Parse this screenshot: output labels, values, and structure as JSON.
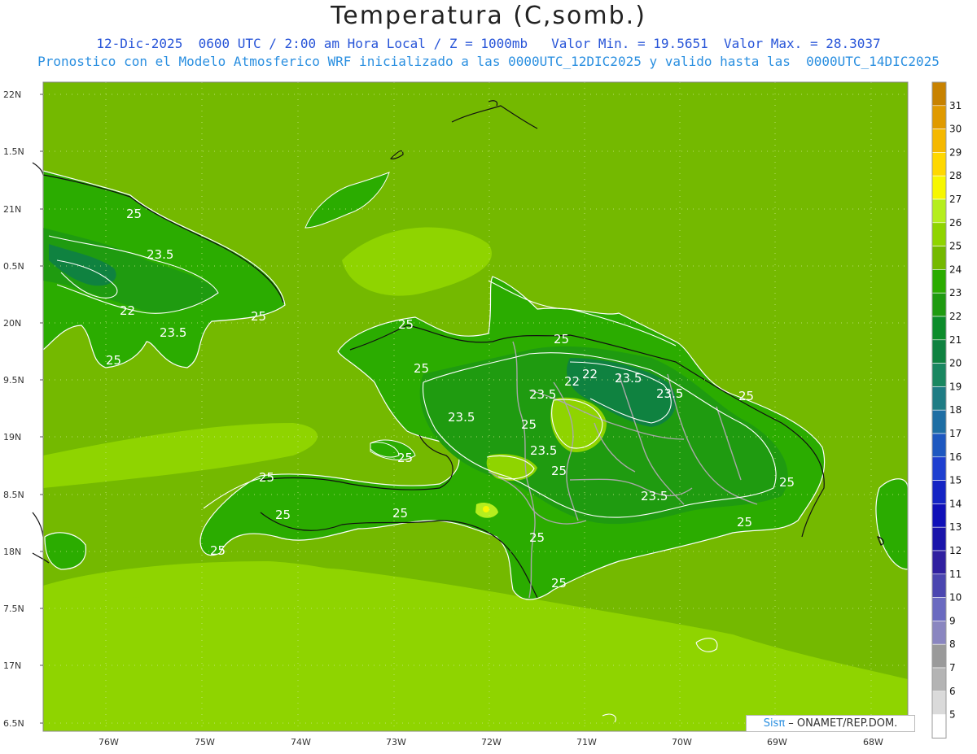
{
  "title": "Temperatura (C,somb.)",
  "subtitle_line1": "12-Dic-2025  0600 UTC / 2:00 am Hora Local / Z = 1000mb   Valor Min. = 19.5651  Valor Max. = 28.3037",
  "subtitle_line2": "Pronostico con el Modelo Atmosferico WRF inicializado a las 0000UTC_12DIC2025 y valido hasta las  0000UTC_14DIC2025",
  "credit": {
    "brand": "Sisπ",
    "text": " – ONAMET/REP.DOM."
  },
  "axes": {
    "x_ticks": [
      "76W",
      "75W",
      "74W",
      "73W",
      "72W",
      "71W",
      "70W",
      "69W",
      "68W"
    ],
    "y_ticks": [
      "22N",
      "1.5N",
      "21N",
      "0.5N",
      "20N",
      "9.5N",
      "19N",
      "8.5N",
      "18N",
      "7.5N",
      "17N",
      "6.5N"
    ]
  },
  "colorbar": {
    "levels": [
      "31",
      "30",
      "29",
      "28",
      "27",
      "26",
      "25",
      "24",
      "23",
      "22",
      "21",
      "20",
      "19",
      "18",
      "17",
      "16",
      "15",
      "14",
      "13",
      "12",
      "11",
      "10",
      "9",
      "8",
      "7",
      "6",
      "5"
    ],
    "colors": [
      "#c88200",
      "#e09a00",
      "#f5b800",
      "#ffd800",
      "#f7f700",
      "#b5ee1e",
      "#8fd400",
      "#74b900",
      "#2bac00",
      "#1f9b10",
      "#0c8c2a",
      "#0f8240",
      "#1a8760",
      "#1f7c84",
      "#1e6ea4",
      "#1e58c0",
      "#1e3fd0",
      "#1424c4",
      "#1010b8",
      "#1a14aa",
      "#3020a0",
      "#4b46b0",
      "#6a6ac0",
      "#8a86c0",
      "#9a9a9a",
      "#b4b4b4",
      "#dadada",
      "#ffffff"
    ]
  },
  "contour_labels": [
    "25",
    "23.5",
    "22",
    "23.5",
    "25",
    "25",
    "25",
    "25",
    "23.5",
    "22",
    "22",
    "23.5",
    "23.5",
    "25",
    "23.5",
    "25",
    "25",
    "23.5",
    "25",
    "25",
    "23.5",
    "25",
    "25",
    "25",
    "25",
    "25",
    "25",
    "25",
    "25"
  ]
}
